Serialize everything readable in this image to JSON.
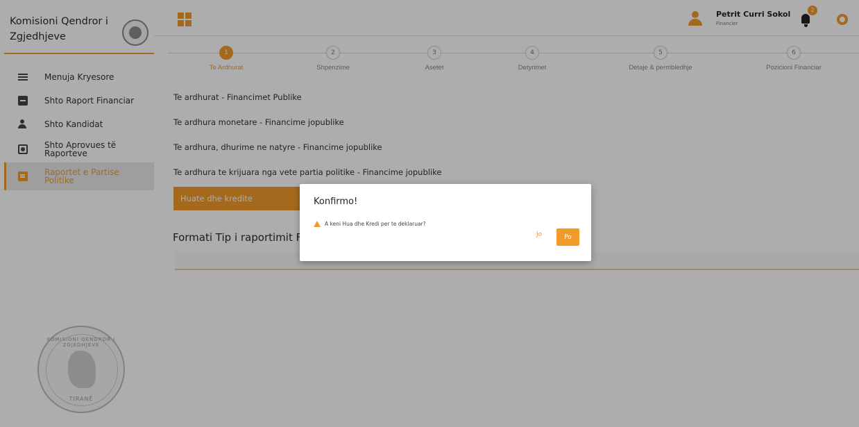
{
  "brand": {
    "title": "Komisioni Qendror i Zgjedhjeve"
  },
  "sidebar": {
    "items": [
      {
        "label": "Menuja Kryesore",
        "icon": "list-icon"
      },
      {
        "label": "Shto Raport Financiar",
        "icon": "card-icon"
      },
      {
        "label": "Shto Kandidat",
        "icon": "user-add-icon"
      },
      {
        "label": "Shto Aprovues të Raporteve",
        "icon": "badge-icon"
      },
      {
        "label": "Raportet e Partise Politike",
        "icon": "document-icon",
        "active": true
      }
    ],
    "seal_top": "KOMISIONI QENDROR I ZGJEDHJEVE",
    "seal_bottom": "TIRANË"
  },
  "header": {
    "user_name": "Petrit Curri Sokol",
    "user_role": "Financier",
    "notifications": "2"
  },
  "stepper": {
    "steps": [
      {
        "num": "1",
        "label": "Te Ardhurat",
        "active": true
      },
      {
        "num": "2",
        "label": "Shpenzime"
      },
      {
        "num": "3",
        "label": "Asetet"
      },
      {
        "num": "4",
        "label": "Detyrimet"
      },
      {
        "num": "5",
        "label": "Detaje & permbledhje"
      },
      {
        "num": "6",
        "label": "Pozicioni Financiar"
      }
    ]
  },
  "content": {
    "rows": [
      "Te ardhurat - Financimet Publike",
      "Te ardhura monetare - Financime jopublike",
      "Te ardhura, dhurime ne natyre - Financime jopublike",
      "Te ardhura te krijuara nga vete partia politike - Financime jopublike",
      "Huate dhe kredite"
    ],
    "section_title": "Formati Tip i raportimit Financiar"
  },
  "modal": {
    "title": "Konfirmo!",
    "message": "A keni Hua dhe Kredi per te deklaruar?",
    "no_label": "Jo",
    "yes_label": "Po"
  },
  "colors": {
    "accent": "#f29b2b",
    "overlay": "rgba(0,0,0,0.32)"
  }
}
